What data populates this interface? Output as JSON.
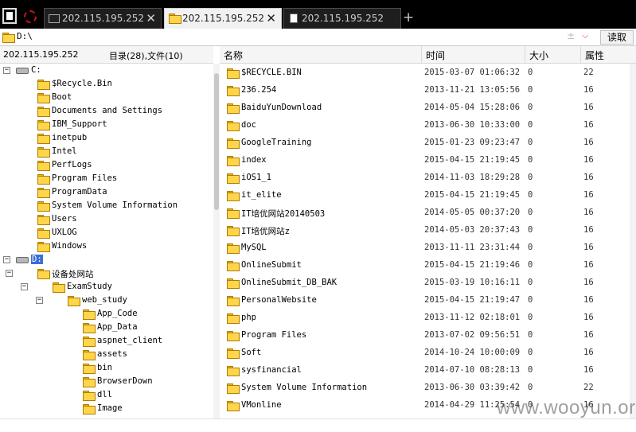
{
  "tabs": [
    {
      "label": "202.115.195.252",
      "icon": "terminal-icon",
      "active": false
    },
    {
      "label": "202.115.195.252",
      "icon": "folder-icon",
      "active": true
    },
    {
      "label": "202.115.195.252",
      "icon": "document-icon",
      "active": false
    }
  ],
  "tab_close_symbol": "✕",
  "tab_add_symbol": "+",
  "address": {
    "path": "D:\\",
    "extra_symbol": "±",
    "dropdown_symbol": "⌵",
    "read_label": "读取"
  },
  "left_panel": {
    "host": "202.115.195.252",
    "summary": "目录(28),文件(10)"
  },
  "tree": [
    {
      "label": "C:",
      "type": "drive",
      "expander": "−",
      "depth": 0
    },
    {
      "label": "$Recycle.Bin",
      "type": "folder",
      "depth": 1
    },
    {
      "label": "Boot",
      "type": "folder",
      "depth": 1
    },
    {
      "label": "Documents and Settings",
      "type": "folder",
      "depth": 1
    },
    {
      "label": "IBM_Support",
      "type": "folder",
      "depth": 1
    },
    {
      "label": "inetpub",
      "type": "folder",
      "depth": 1
    },
    {
      "label": "Intel",
      "type": "folder",
      "depth": 1
    },
    {
      "label": "PerfLogs",
      "type": "folder",
      "depth": 1
    },
    {
      "label": "Program Files",
      "type": "folder",
      "depth": 1
    },
    {
      "label": "ProgramData",
      "type": "folder",
      "depth": 1
    },
    {
      "label": "System Volume Information",
      "type": "folder",
      "depth": 1
    },
    {
      "label": "Users",
      "type": "folder",
      "depth": 1
    },
    {
      "label": "UXLOG",
      "type": "folder",
      "depth": 1
    },
    {
      "label": "Windows",
      "type": "folder",
      "depth": 1
    },
    {
      "label": "D:",
      "type": "drive",
      "expander": "−",
      "depth": 0,
      "selected": true
    },
    {
      "label": "设备处网站",
      "type": "folder",
      "expander": "−",
      "depth": 1
    },
    {
      "label": "ExamStudy",
      "type": "folder",
      "expander": "−",
      "depth": 2
    },
    {
      "label": "web_study",
      "type": "folder",
      "expander": "−",
      "depth": 3
    },
    {
      "label": "App_Code",
      "type": "folder",
      "depth": 4
    },
    {
      "label": "App_Data",
      "type": "folder",
      "depth": 4
    },
    {
      "label": "aspnet_client",
      "type": "folder",
      "depth": 4
    },
    {
      "label": "assets",
      "type": "folder",
      "depth": 4
    },
    {
      "label": "bin",
      "type": "folder",
      "depth": 4
    },
    {
      "label": "BrowserDown",
      "type": "folder",
      "depth": 4
    },
    {
      "label": "dll",
      "type": "folder",
      "depth": 4
    },
    {
      "label": "Image",
      "type": "folder",
      "depth": 4
    }
  ],
  "columns": {
    "name": "名称",
    "time": "时间",
    "size": "大小",
    "attr": "属性"
  },
  "files": [
    {
      "name": "$RECYCLE.BIN",
      "time": "2015-03-07 01:06:32",
      "size": "0",
      "attr": "22"
    },
    {
      "name": "236.254",
      "time": "2013-11-21 13:05:56",
      "size": "0",
      "attr": "16"
    },
    {
      "name": "BaiduYunDownload",
      "time": "2014-05-04 15:28:06",
      "size": "0",
      "attr": "16"
    },
    {
      "name": "doc",
      "time": "2013-06-30 10:33:00",
      "size": "0",
      "attr": "16"
    },
    {
      "name": "GoogleTraining",
      "time": "2015-01-23 09:23:47",
      "size": "0",
      "attr": "16"
    },
    {
      "name": "index",
      "time": "2015-04-15 21:19:45",
      "size": "0",
      "attr": "16"
    },
    {
      "name": "iOS1_1",
      "time": "2014-11-03 18:29:28",
      "size": "0",
      "attr": "16"
    },
    {
      "name": "it_elite",
      "time": "2015-04-15 21:19:45",
      "size": "0",
      "attr": "16"
    },
    {
      "name": "IT培优网站20140503",
      "time": "2014-05-05 00:37:20",
      "size": "0",
      "attr": "16"
    },
    {
      "name": "IT培优网站z",
      "time": "2014-05-03 20:37:43",
      "size": "0",
      "attr": "16"
    },
    {
      "name": "MySQL",
      "time": "2013-11-11 23:31:44",
      "size": "0",
      "attr": "16"
    },
    {
      "name": "OnlineSubmit",
      "time": "2015-04-15 21:19:46",
      "size": "0",
      "attr": "16"
    },
    {
      "name": "OnlineSubmit_DB_BAK",
      "time": "2015-03-19 10:16:11",
      "size": "0",
      "attr": "16"
    },
    {
      "name": "PersonalWebsite",
      "time": "2015-04-15 21:19:47",
      "size": "0",
      "attr": "16"
    },
    {
      "name": "php",
      "time": "2013-11-12 02:18:01",
      "size": "0",
      "attr": "16"
    },
    {
      "name": "Program Files",
      "time": "2013-07-02 09:56:51",
      "size": "0",
      "attr": "16"
    },
    {
      "name": "Soft",
      "time": "2014-10-24 10:00:09",
      "size": "0",
      "attr": "16"
    },
    {
      "name": "sysfinancial",
      "time": "2014-07-10 08:28:13",
      "size": "0",
      "attr": "16"
    },
    {
      "name": "System Volume Information",
      "time": "2013-06-30 03:39:42",
      "size": "0",
      "attr": "22"
    },
    {
      "name": "VMonline",
      "time": "2014-04-29 11:25:54",
      "size": "0",
      "attr": "16"
    }
  ],
  "watermark": "www.wooyun.org",
  "colors": {
    "selection": "#3a6fd8",
    "folder": "#ffd54a",
    "tabbar": "#000000"
  }
}
